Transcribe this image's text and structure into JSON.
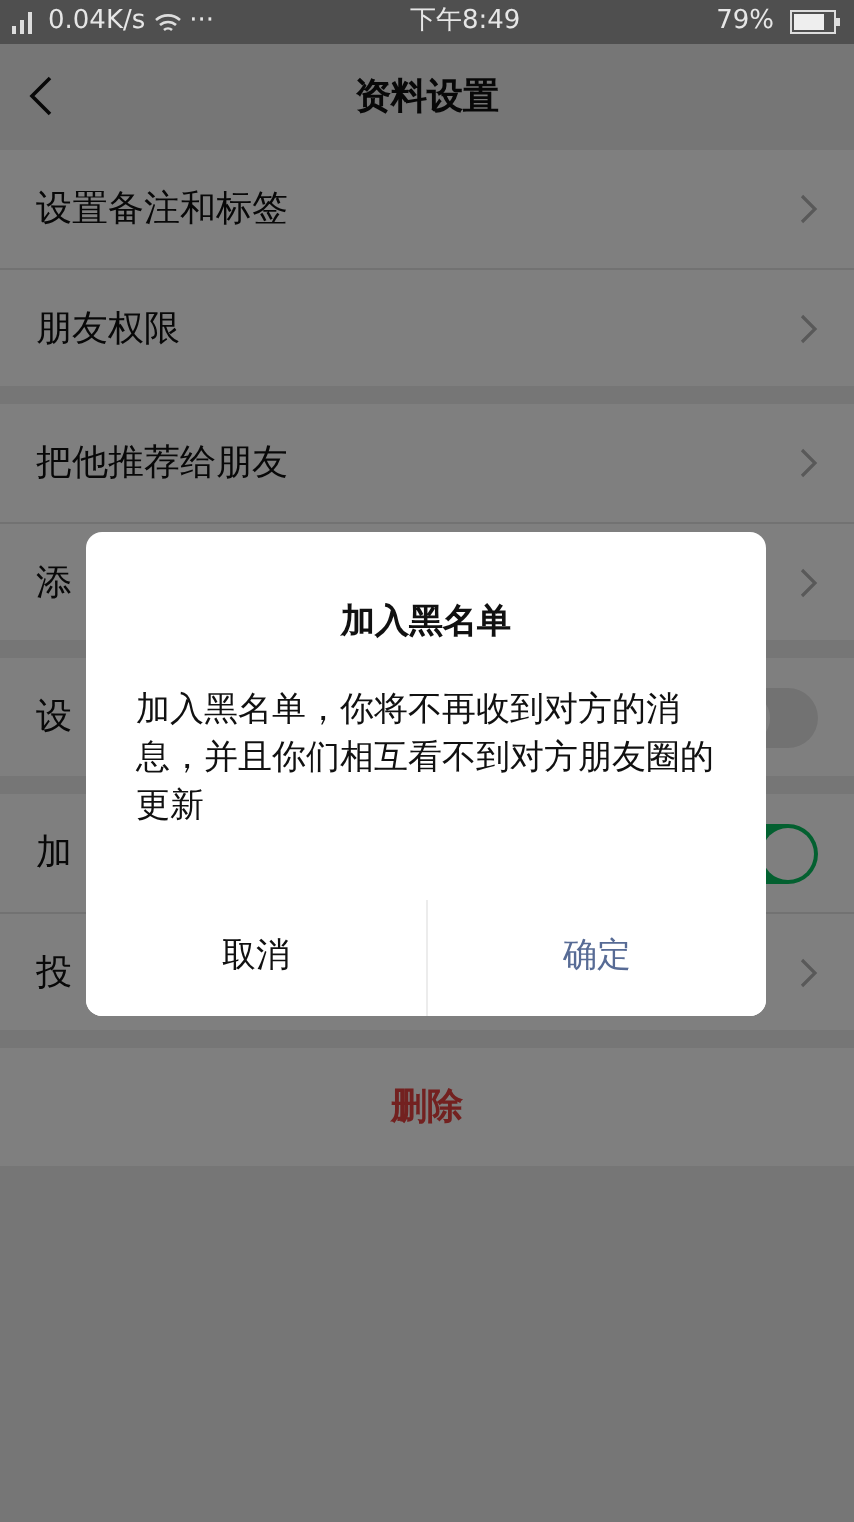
{
  "status_bar": {
    "network_speed": "0.04K/s",
    "more": "···",
    "time": "下午8:49",
    "battery": "79%"
  },
  "header": {
    "title": "资料设置"
  },
  "groups": [
    {
      "rows": [
        {
          "label": "设置备注和标签",
          "kind": "link"
        },
        {
          "label": "朋友权限",
          "kind": "link"
        }
      ]
    },
    {
      "rows": [
        {
          "label": "把他推荐给朋友",
          "kind": "link"
        },
        {
          "label": "添",
          "kind": "link"
        }
      ]
    },
    {
      "rows": [
        {
          "label": "设",
          "kind": "toggle",
          "on": false
        }
      ]
    },
    {
      "rows": [
        {
          "label": "加",
          "kind": "toggle",
          "on": true
        },
        {
          "label": "投",
          "kind": "link"
        }
      ]
    },
    {
      "rows": [
        {
          "label": "删除",
          "kind": "danger"
        }
      ]
    }
  ],
  "dialog": {
    "title": "加入黑名单",
    "message": "加入黑名单，你将不再收到对方的消息，并且你们相互看不到对方朋友圈的更新",
    "buttons": [
      {
        "label": "取消",
        "kind": "cancel"
      },
      {
        "label": "确定",
        "kind": "confirm"
      }
    ]
  }
}
